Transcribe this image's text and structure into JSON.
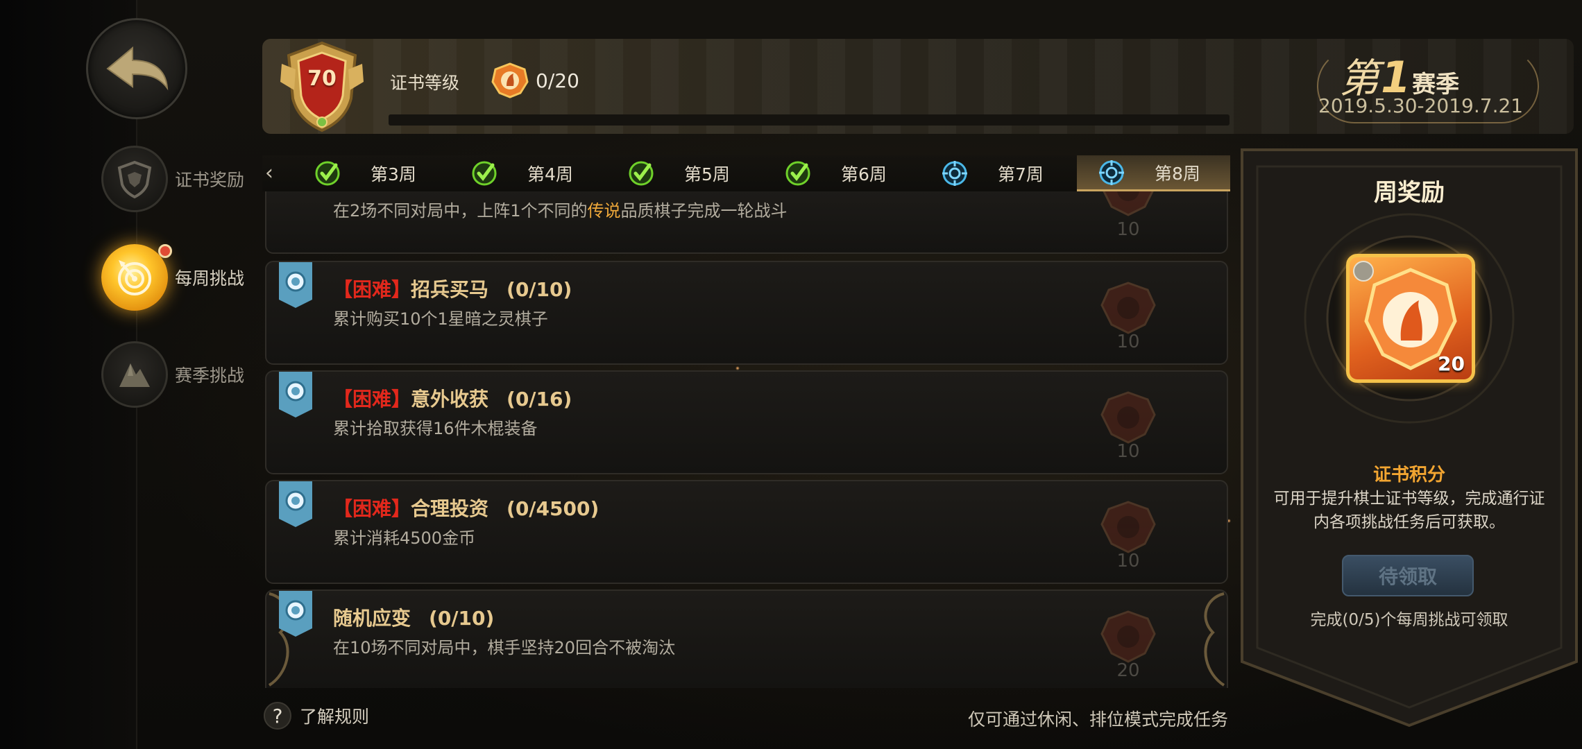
{
  "header": {
    "level": "70",
    "cert_level_label": "证书等级",
    "token_progress": "0/20",
    "season": {
      "prefix": "第",
      "number": "1",
      "suffix": "赛季",
      "dates": "2019.5.30-2019.7.21"
    }
  },
  "sidebar": {
    "items": [
      {
        "label": "证书奖励",
        "icon": "shield-icon",
        "active": false
      },
      {
        "label": "每周挑战",
        "icon": "target-icon",
        "active": true
      },
      {
        "label": "赛季挑战",
        "icon": "mountain-icon",
        "active": false
      }
    ]
  },
  "week_tabs": [
    {
      "label": "第3周",
      "status": "completed"
    },
    {
      "label": "第4周",
      "status": "completed"
    },
    {
      "label": "第5周",
      "status": "completed"
    },
    {
      "label": "第6周",
      "status": "completed"
    },
    {
      "label": "第7周",
      "status": "current"
    },
    {
      "label": "第8周",
      "status": "current",
      "selected": true
    }
  ],
  "tasks": [
    {
      "desc_pre": "在2场不同对局中，上阵1个不同的",
      "desc_hl": "传说",
      "desc_post": "品质棋子完成一轮战斗",
      "reward": "10"
    },
    {
      "tag": "【困难】",
      "title": "招兵买马",
      "progress": "(0/10)",
      "desc": "累计购买10个1星暗之灵棋子",
      "reward": "10"
    },
    {
      "tag": "【困难】",
      "title": "意外收获",
      "progress": "(0/16)",
      "desc": "累计拾取获得16件木棍装备",
      "reward": "10"
    },
    {
      "tag": "【困难】",
      "title": "合理投资",
      "progress": "(0/4500)",
      "desc": "累计消耗4500金币",
      "reward": "10"
    },
    {
      "tag": "",
      "title": "随机应变",
      "progress": "(0/10)",
      "desc": "在10场不同对局中，棋手坚持20回合不被淘汰",
      "reward": "20"
    }
  ],
  "reward_panel": {
    "title": "周奖励",
    "item_count": "20",
    "points_label": "证书积分",
    "points_desc": "可用于提升棋士证书等级，完成通行证内各项挑战任务后可获取。",
    "claim_button": "待领取",
    "claim_hint": "完成(0/5)个每周挑战可领取"
  },
  "footer": {
    "help_icon": "?",
    "help_label": "了解规则",
    "mode_note": "仅可通过休闲、排位模式完成任务"
  },
  "colors": {
    "accent_gold": "#e7c98f",
    "hard_red": "#e2281c",
    "legend_orange": "#f0a93a",
    "points_orange": "#f2a531"
  }
}
